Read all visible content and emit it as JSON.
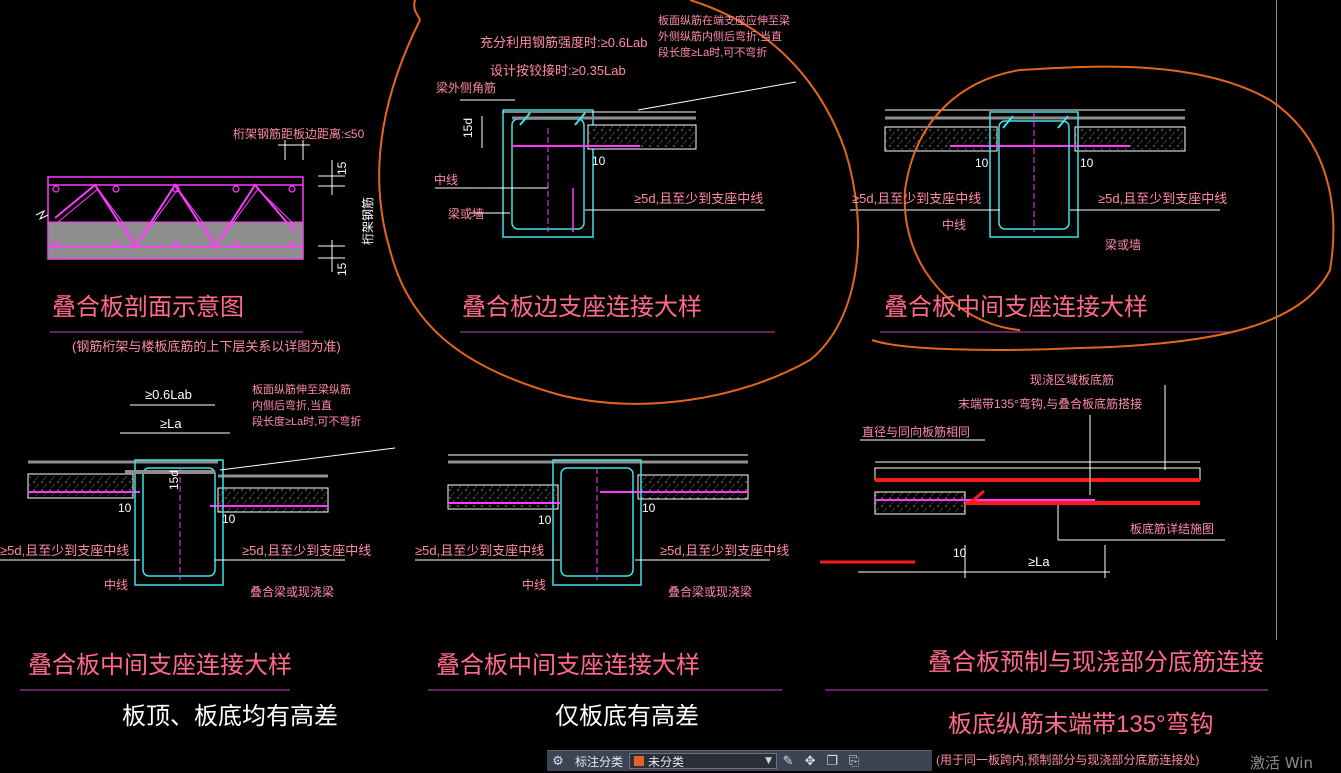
{
  "colors": {
    "background": "#000000",
    "title_text": "#ff6a8a",
    "note_text": "#ff8aa8",
    "beam": "#3de2e8",
    "rebar": "#ff3bff",
    "slab_fill": "#8e8e8e",
    "dim": "#ffffff",
    "markup": "#e2661c",
    "title_underline": "#c844c8"
  },
  "drawings": {
    "section": {
      "title": "叠合板剖面示意图",
      "note": "(钢筋桁架与楼板底筋的上下层关系以详图为准)",
      "label_truss_dist": "桁架钢筋距板边距离:≤50",
      "label_truss_rebar": "桁架钢筋",
      "dim_top": "15",
      "dim_bottom": "15"
    },
    "edge_support": {
      "title": "叠合板边支座连接大样",
      "note_full": "充分利用钢筋强度时:≥0.6Lab",
      "note_design": "设计按铰接时:≥0.35Lab",
      "note_top_rebar": "板面纵筋在端支座应伸至梁外侧纵筋内侧后弯折,当直段长度≥La时,可不弯折",
      "label_side_rebar": "梁外侧角筋",
      "label_15d": "15d",
      "label_10": "10",
      "label_center": "中线",
      "label_beam": "梁或墙",
      "label_5d": "≥5d,且至少到支座中线"
    },
    "middle_support": {
      "title": "叠合板中间支座连接大样",
      "label_10_left": "10",
      "label_10_right": "10",
      "label_5d_left": "≥5d,且至少到支座中线",
      "label_5d_right": "≥5d,且至少到支座中线",
      "label_center": "中线",
      "label_beam": "梁或墙"
    },
    "middle_both": {
      "title": "叠合板中间支座连接大样",
      "subtitle": "板顶、板底均有高差",
      "label_lab": "≥0.6Lab",
      "label_la": "≥La",
      "note_top": "板面纵筋伸至梁纵筋内侧后弯折,当直段长度≥La时,可不弯折",
      "label_15d": "15d",
      "label_10_left": "10",
      "label_10_right": "10",
      "label_5d_left": "≥5d,且至少到支座中线",
      "label_5d_right": "≥5d,且至少到支座中线",
      "label_center": "中线",
      "label_beam": "叠合梁或现浇梁"
    },
    "middle_bottom": {
      "title": "叠合板中间支座连接大样",
      "subtitle": "仅板底有高差",
      "label_10_left": "10",
      "label_10_right": "10",
      "label_5d_left": "≥5d,且至少到支座中线",
      "label_5d_right": "≥5d,且至少到支座中线",
      "label_center": "中线",
      "label_beam": "叠合梁或现浇梁"
    },
    "precast_cast": {
      "title": "叠合板预制与现浇部分底筋连接",
      "subtitle": "板底纵筋末端带135°弯钩",
      "note": "(用于同一板跨内,预制部分与现浇部分底筋连接处)",
      "label_cast_bottom": "现浇区域板底筋",
      "label_hook": "末端带135°弯钩,与叠合板底筋搭接",
      "label_diameter": "直径与同向板筋相同",
      "label_detail": "板底筋详结施图",
      "label_10": "10",
      "label_la": "≥La"
    }
  },
  "toolbar": {
    "annot_label": "标注分类",
    "category_value": "未分类"
  },
  "watermark": "激活 Win"
}
